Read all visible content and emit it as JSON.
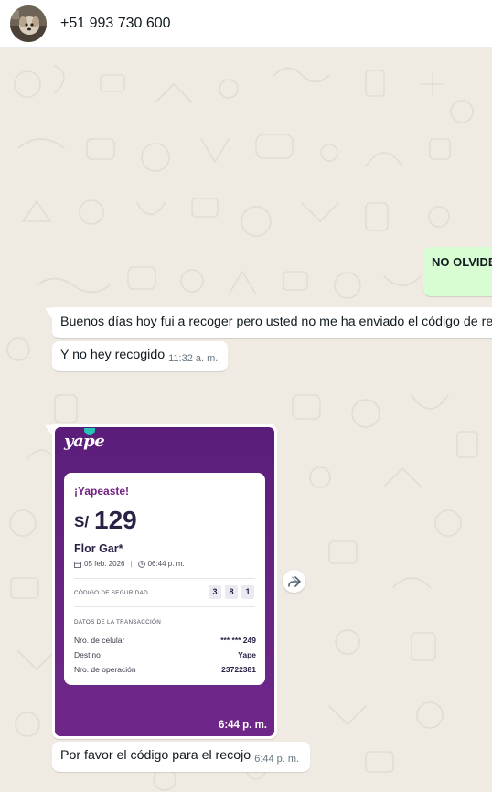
{
  "header": {
    "contact_name": "+51 993 730 600"
  },
  "messages": {
    "m1_text": "NO OLVIDE",
    "m2_text": "Buenos días hoy fui a recoger pero usted no me ha enviado el código de re",
    "m3_text": "Y no hey recogido",
    "m3_time": "11:32 a. m.",
    "m5_text": "Por favor el código para el recojo",
    "m5_time": "6:44 p. m."
  },
  "image_message": {
    "time": "6:44 p. m.",
    "logo": "yape",
    "title": "¡Yapeaste!",
    "currency": "S/",
    "amount": "129",
    "recipient": "Flor Gar*",
    "date": "05 feb. 2026",
    "separator": "|",
    "hour": "06:44 p. m.",
    "security_label": "CÓDIGO DE SEGURIDAD",
    "security_digits": [
      "3",
      "8",
      "1"
    ],
    "details_label": "DATOS DE LA TRANSACCIÓN",
    "rows": [
      {
        "label": "Nro. de celular",
        "value": "*** *** 249"
      },
      {
        "label": "Destino",
        "value": "Yape"
      },
      {
        "label": "Nro. de operación",
        "value": "23722381"
      }
    ]
  },
  "colors": {
    "chat_bg": "#efeae2",
    "outgoing": "#d9fdd3",
    "incoming": "#ffffff",
    "yape_purple": "#6a2484"
  }
}
